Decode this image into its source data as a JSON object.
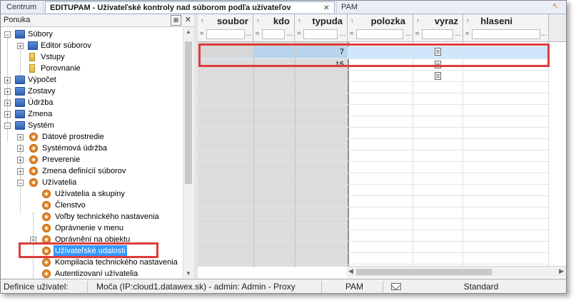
{
  "tabs": [
    {
      "label": "Centrum"
    },
    {
      "label": "EDITUPAM - Užívateľské kontroly nad súborom podľa užívateľov",
      "close": "⨯"
    },
    {
      "label": "PAM"
    }
  ],
  "panel": {
    "title": "Ponuka",
    "pin": "⊞",
    "close": "✕"
  },
  "tree": [
    {
      "label": "Súbory",
      "expander": "−"
    },
    {
      "label": "Editor súborov",
      "expander": "+"
    },
    {
      "label": "Vstupy"
    },
    {
      "label": "Porovnanie"
    },
    {
      "label": "Výpočet",
      "expander": "+"
    },
    {
      "label": "Zostavy",
      "expander": "+"
    },
    {
      "label": "Údržba",
      "expander": "+"
    },
    {
      "label": "Zmena",
      "expander": "+"
    },
    {
      "label": "Systém",
      "expander": "−"
    },
    {
      "label": "Dátové prostredie",
      "expander": "+"
    },
    {
      "label": "Systémová údržba",
      "expander": "+"
    },
    {
      "label": "Preverenie",
      "expander": "+"
    },
    {
      "label": "Zmena definícií súborov",
      "expander": "+"
    },
    {
      "label": "Užívatelia",
      "expander": "−"
    },
    {
      "label": "Užívatelia a skupiny"
    },
    {
      "label": "Členstvo"
    },
    {
      "label": "Voľby technického nastavenia"
    },
    {
      "label": "Oprávnenie v menu"
    },
    {
      "label": "Oprávnění na objektu",
      "expander": "+"
    },
    {
      "label": "Užívateľské udalosti"
    },
    {
      "label": "Kompilacia technického nastavenia"
    },
    {
      "label": "Autentizovaní užívatelia"
    }
  ],
  "grid": {
    "columns": [
      {
        "title": "soubor",
        "sort": "↑",
        "op": "≈"
      },
      {
        "title": "kdo",
        "sort": "↑",
        "op": "≈"
      },
      {
        "title": "typuda",
        "sort": "↑",
        "op": "="
      },
      {
        "title": "polozka",
        "sort": "↑",
        "op": "≈"
      },
      {
        "title": "vyraz",
        "sort": "↑",
        "op": "≈"
      },
      {
        "title": "hlaseni",
        "sort": "↑",
        "op": "≈"
      }
    ],
    "filter_dots": "...",
    "rows": [
      {
        "soubor": "",
        "kdo": "",
        "typuda": "7",
        "polozka": "",
        "vyraz_icon": "document-icon",
        "hlaseni": ""
      },
      {
        "soubor": "",
        "kdo": "",
        "typuda": "15",
        "polozka": "",
        "vyraz_icon": "document-icon",
        "hlaseni": ""
      },
      {
        "soubor": "",
        "kdo": "",
        "typuda": "",
        "polozka": "",
        "vyraz_icon": "document-icon",
        "hlaseni": ""
      }
    ]
  },
  "status": {
    "field": "Definice uživatel:",
    "connection": "Moča (IP:cloud1.datawex.sk) - admin: Admin - Proxy",
    "module": "PAM",
    "mode": "Standard"
  },
  "colors": {
    "accent": "#3399ff",
    "highlight": "#e03b3b",
    "selected_row": "#cfe6fb"
  }
}
